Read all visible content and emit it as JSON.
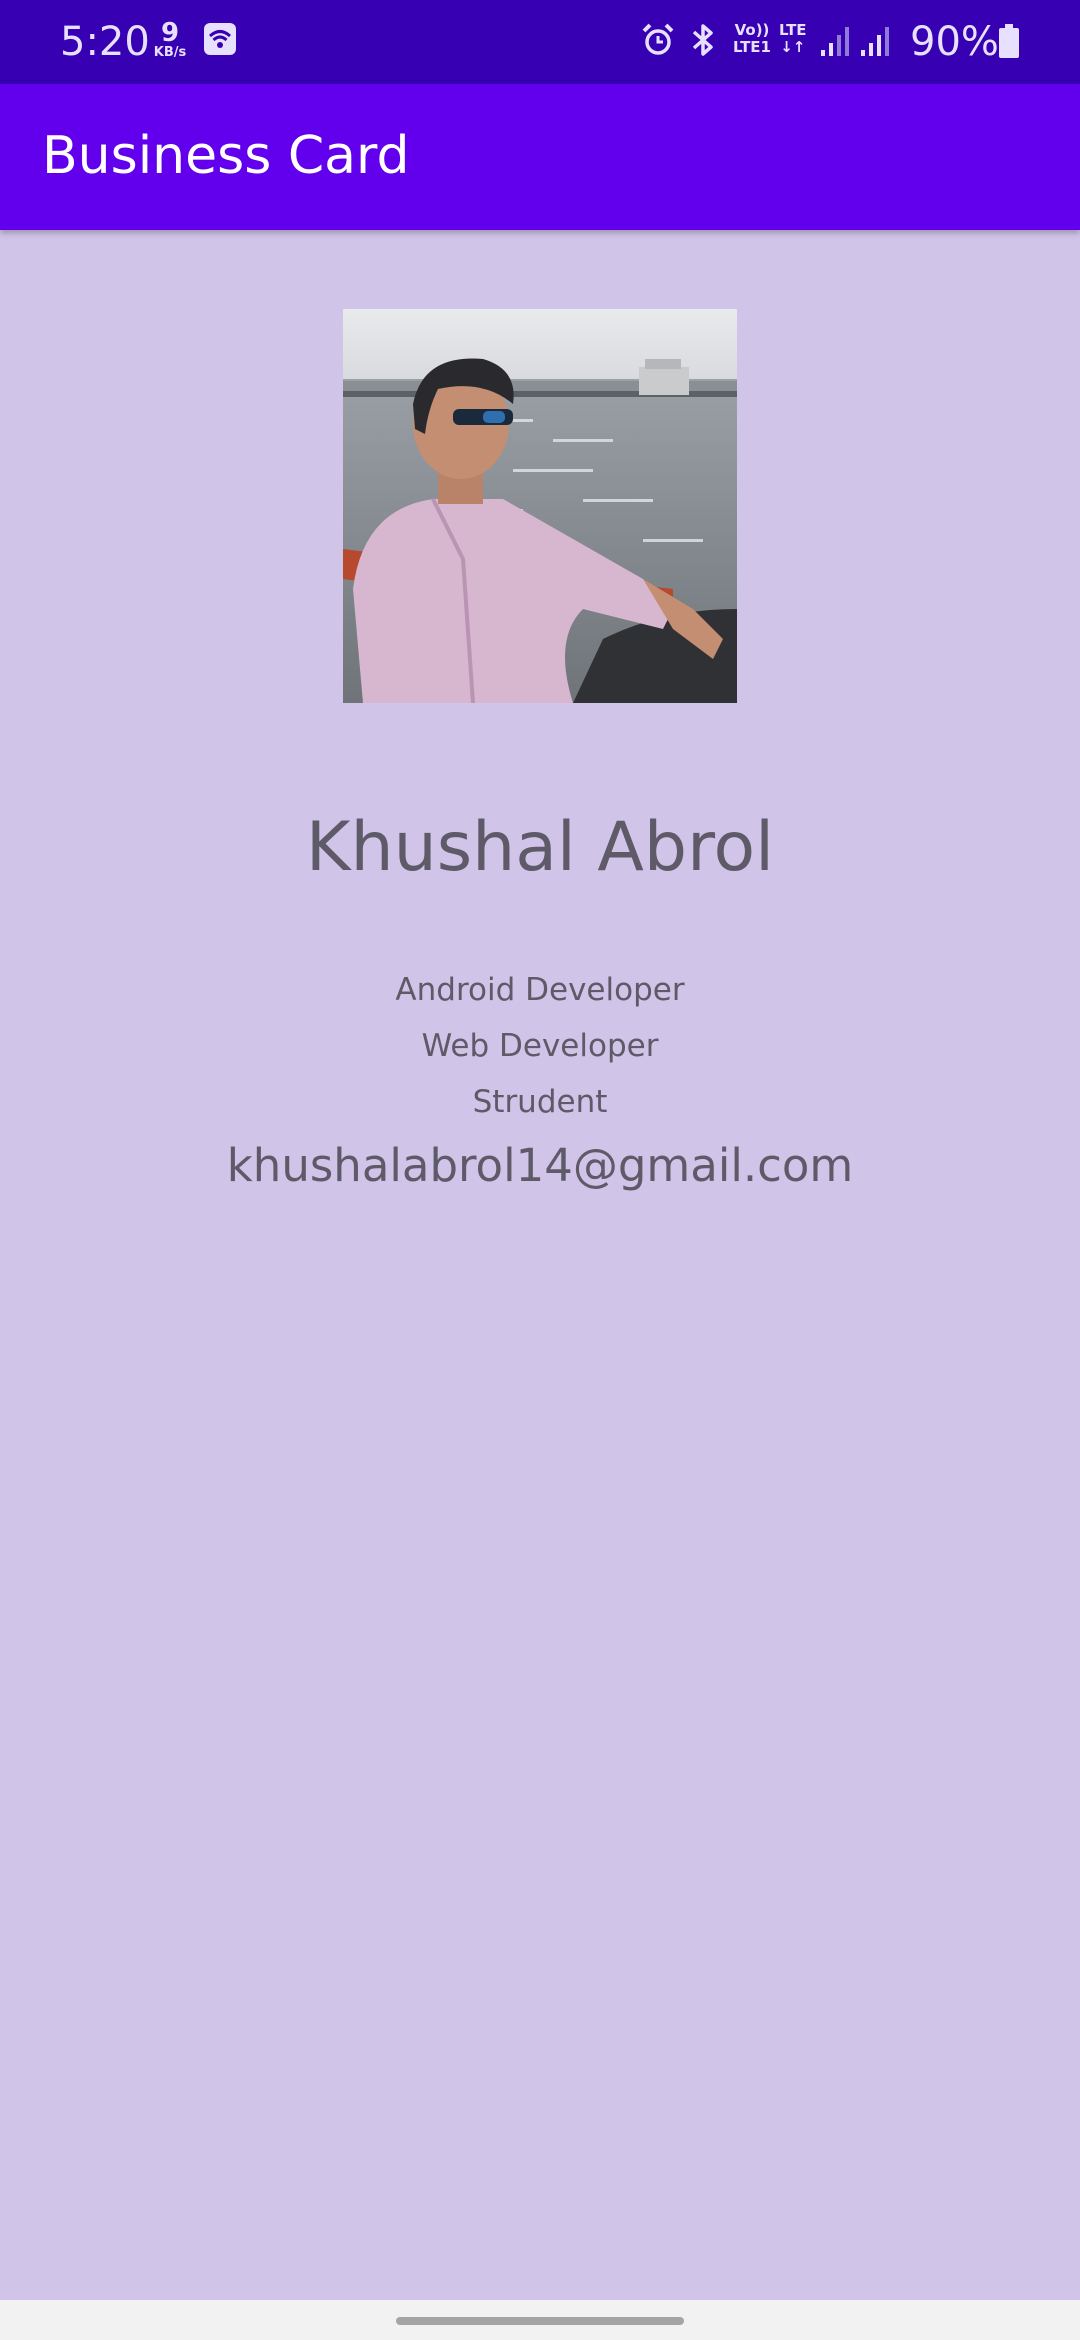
{
  "status_bar": {
    "time": "5:20",
    "net_speed_value": "9",
    "net_speed_unit": "KB/s",
    "volte_top": "Vo))",
    "volte_bottom": "LTE1",
    "lte_label": "LTE",
    "battery": "90%",
    "icons": [
      "wifi-icon",
      "alarm-icon",
      "bluetooth-icon",
      "volte-icon",
      "lte-icon",
      "signal-icon",
      "signal-icon",
      "battery-icon"
    ]
  },
  "app_bar": {
    "title": "Business Card"
  },
  "profile": {
    "photo": "profile-photo",
    "name": "Khushal Abrol",
    "roles": [
      "Android Developer",
      "Web Developer",
      "Strudent"
    ],
    "email": "khushalabrol14@gmail.com"
  },
  "colors": {
    "background": "#d1c4e9",
    "status_bar": "#3700b3",
    "app_bar": "#6200ee",
    "text": "#5e5a67"
  }
}
